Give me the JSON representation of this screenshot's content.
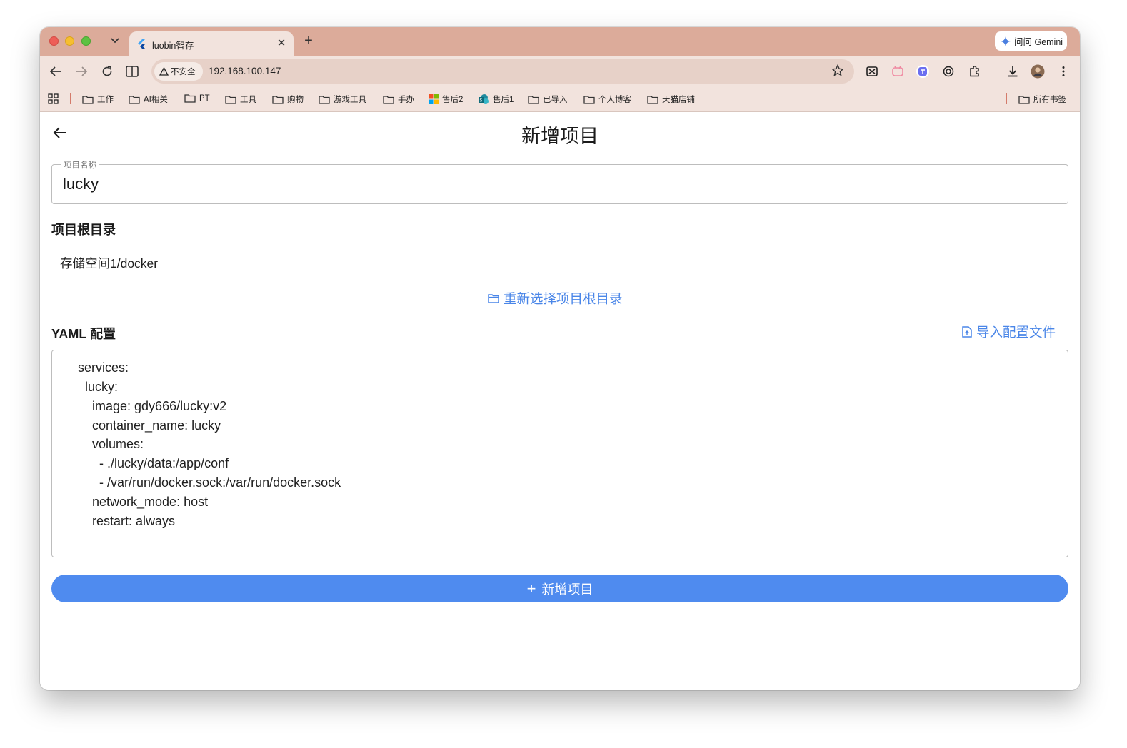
{
  "browser": {
    "tab_title": "luobin智存",
    "close_glyph": "✕",
    "new_tab_glyph": "+",
    "gemini_label": "问问 Gemini",
    "security_label": "不安全",
    "url": "192.168.100.147"
  },
  "bookmarks": {
    "items": [
      "工作",
      "AI相关",
      "PT",
      "工具",
      "购物",
      "游戏工具",
      "手办",
      "售后2",
      "售后1",
      "已导入",
      "个人博客",
      "天猫店铺"
    ],
    "all_bookmarks": "所有书签"
  },
  "page": {
    "title": "新增项目",
    "name_field": {
      "label": "项目名称",
      "value": "lucky"
    },
    "root_section_title": "项目根目录",
    "root_path": "存储空间1/docker",
    "reselect_label": "重新选择项目根目录",
    "yaml_section_title": "YAML 配置",
    "import_label": "导入配置文件",
    "yaml_lines": [
      "services:",
      "  lucky:",
      "    image: gdy666/lucky:v2",
      "    container_name: lucky",
      "    volumes:",
      "      - ./lucky/data:/app/conf",
      "      - /var/run/docker.sock:/var/run/docker.sock",
      "    network_mode: host",
      "    restart: always"
    ],
    "submit_label": "新增项目",
    "submit_icon": "+"
  },
  "colors": {
    "accent": "#4f8bef",
    "link": "#4a86e8",
    "tab_strip": "#dcab9a",
    "toolbar": "#f2e3dd"
  }
}
